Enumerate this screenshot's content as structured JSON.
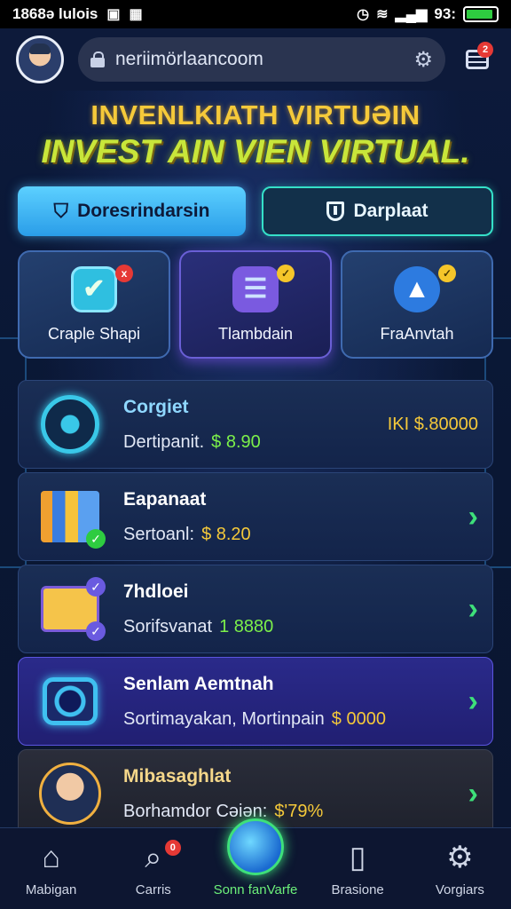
{
  "statusbar": {
    "left_text": "1868ə lulois",
    "time": "93:",
    "battery_level": 0.9
  },
  "header": {
    "url": "neriimörlaancoom",
    "menu_badge": "2"
  },
  "hero": {
    "title_line1": "INVENLKIATH VIRTUƏIN",
    "title_line2": "INVEST AIN VIEN VIRTUAL."
  },
  "actions": {
    "primary_label": "Doresrindarsin",
    "secondary_label": "Darplaat"
  },
  "categories": [
    {
      "label": "Craple Shapi",
      "icon": "checkbox-icon",
      "badge": "x"
    },
    {
      "label": "Tlambdain",
      "icon": "document-icon",
      "badge": "✓"
    },
    {
      "label": "FraAnvtah",
      "icon": "rocket-icon",
      "badge": "✓"
    }
  ],
  "rows": [
    {
      "title": "Corgiet",
      "sub_label": "Dertipanit.",
      "amount": "$ 8.90",
      "right_value": "IKI $.80000",
      "icon": "target-icon"
    },
    {
      "title": "Eapanaat",
      "sub_label": "Sertoanl:",
      "amount": "$ 8.20",
      "icon": "books-icon"
    },
    {
      "title": "7hdloei",
      "sub_label": "Sorifsvanat",
      "amount": "1 8880",
      "icon": "folder-icon"
    },
    {
      "title": "Senlam Aemtnah",
      "sub_label": "Sortimayakan, Mortinpain",
      "amount": "$ 0000",
      "icon": "camera-icon"
    },
    {
      "title": "Mibasaghlat",
      "sub_label": "Borhamdor Cəiən:",
      "amount": "$'79%",
      "icon": "person-icon"
    }
  ],
  "nav": [
    {
      "label": "Mabigan",
      "icon": "home-icon"
    },
    {
      "label": "Carris",
      "icon": "search-check-icon",
      "badge": "0"
    },
    {
      "label": "Sonn fanVarfe",
      "icon": "globe-icon"
    },
    {
      "label": "Brasione",
      "icon": "tablet-icon"
    },
    {
      "label": "Vorgiars",
      "icon": "gear-icon"
    }
  ]
}
